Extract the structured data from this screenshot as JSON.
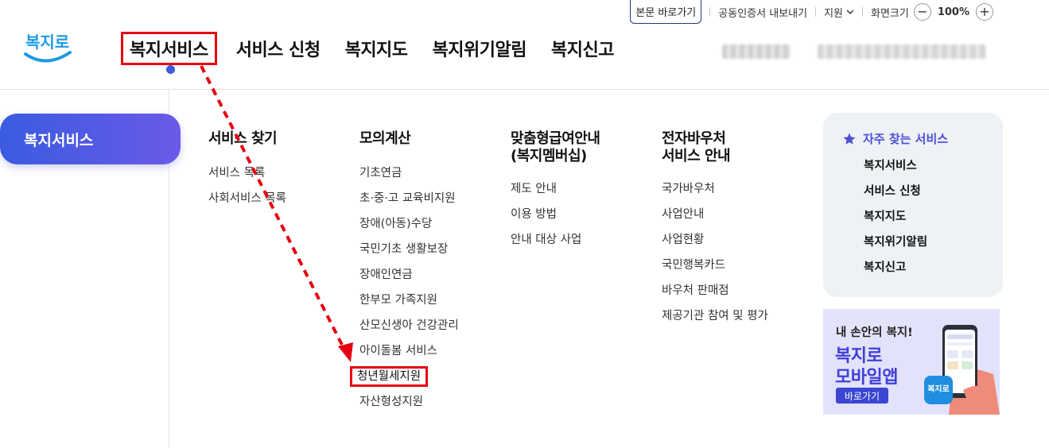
{
  "utility": {
    "skip_link": "본문 바로가기",
    "certificate": "공동인증서 내보내기",
    "support": "지원",
    "zoom_label": "화면크기",
    "zoom_value": "100%",
    "zoom_minus": "−",
    "zoom_plus": "+"
  },
  "logo": {
    "text": "복지로"
  },
  "gnb": [
    "복지서비스",
    "서비스 신청",
    "복지지도",
    "복지위기알림",
    "복지신고"
  ],
  "side": {
    "active_label": "복지서비스"
  },
  "columns": [
    {
      "title": "서비스 찾기",
      "items": [
        "서비스 목록",
        "사회서비스 목록"
      ]
    },
    {
      "title": "모의계산",
      "items": [
        "기초연금",
        "초·중·고 교육비지원",
        "장애(아동)수당",
        "국민기초 생활보장",
        "장애인연금",
        "한부모 가족지원",
        "산모신생아 건강관리",
        "아이돌봄 서비스",
        "청년월세지원",
        "자산형성지원"
      ]
    },
    {
      "title": "맞춤형급여안내\n(복지멤버십)",
      "items": [
        "제도 안내",
        "이용 방법",
        "안내 대상 사업"
      ]
    },
    {
      "title": "전자바우처\n서비스 안내",
      "items": [
        "국가바우처",
        "사업안내",
        "사업현황",
        "국민행복카드",
        "바우처 판매점",
        "제공기관 참여 및 평가"
      ]
    }
  ],
  "favorites": {
    "title": "자주 찾는 서비스",
    "items": [
      "복지서비스",
      "서비스 신청",
      "복지지도",
      "복지위기알림",
      "복지신고"
    ]
  },
  "banner": {
    "subtitle": "내 손안의 복지!",
    "title_line1": "복지로",
    "title_line2": "모바일앱",
    "button": "바로가기",
    "app_icon_text": "복지로"
  },
  "colors": {
    "highlight": "#e60012",
    "accent_blue": "#3b5bd8",
    "pill_gradient_start": "#3a5be0",
    "pill_gradient_end": "#6a5ae8",
    "fav_title": "#4a4fd6"
  }
}
